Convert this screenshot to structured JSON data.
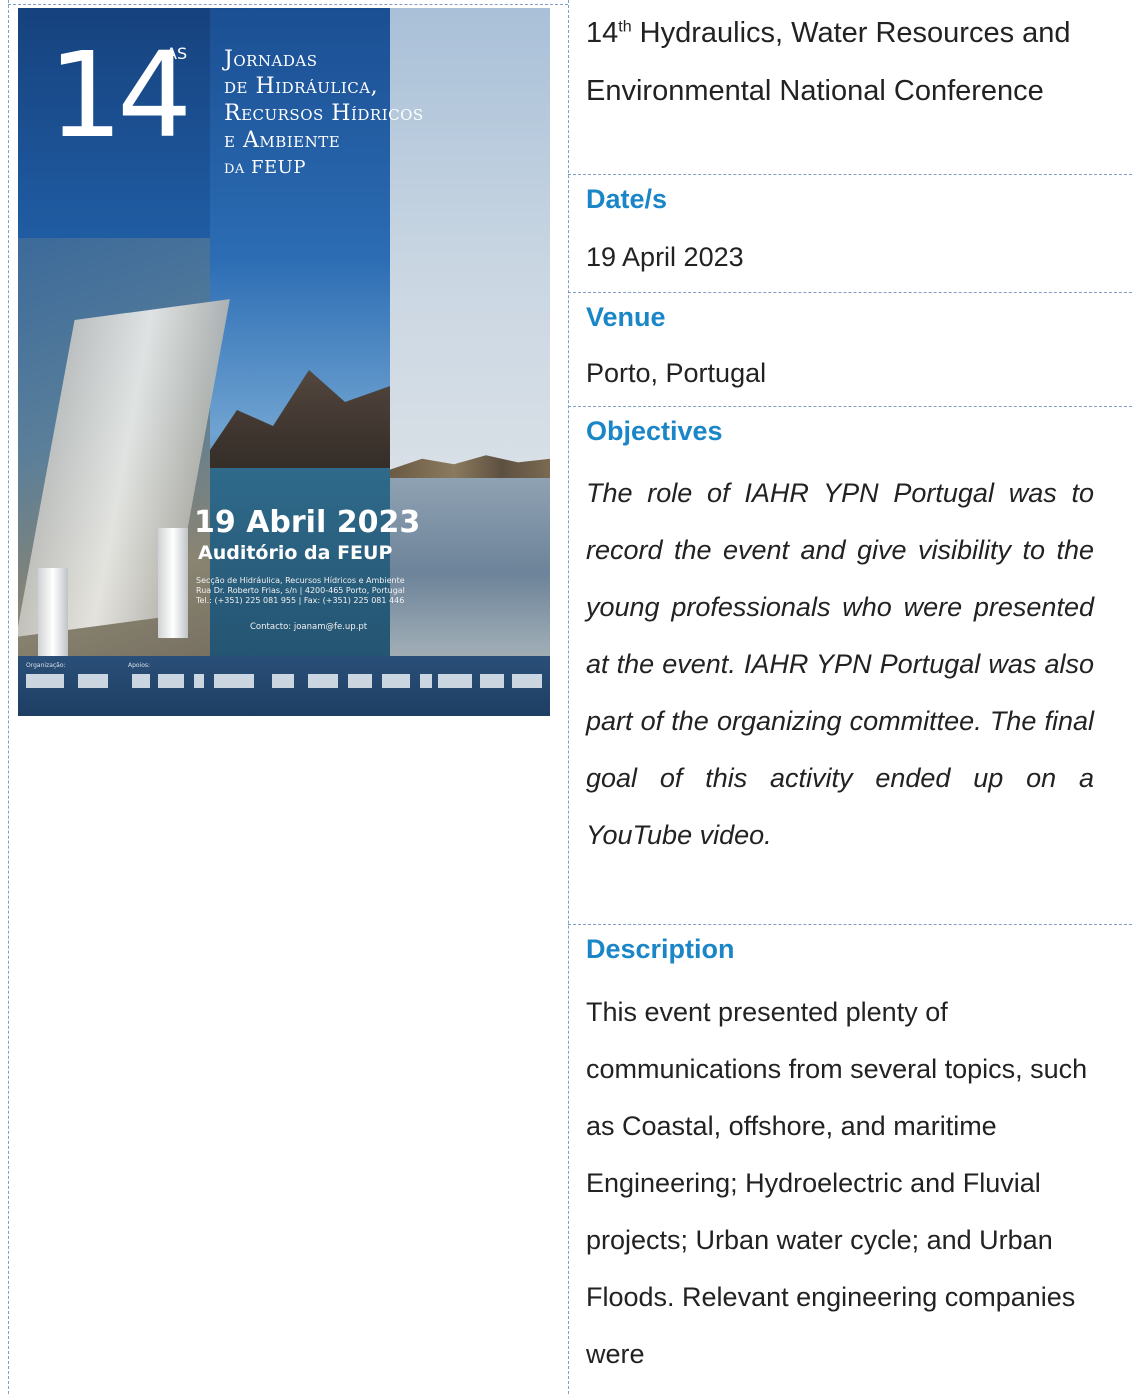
{
  "poster": {
    "number": "14",
    "superscript": "AS",
    "title_lines": [
      "Jornadas",
      "de Hidráulica,",
      "Recursos Hídricos",
      "e Ambiente"
    ],
    "title_small": "da FEUP",
    "date": "19 Abril 2023",
    "venue": "Auditório da FEUP",
    "address_lines": [
      "Secção de Hidráulica, Recursos Hídricos e Ambiente",
      "Rua Dr. Roberto Frias, s/n | 4200-465 Porto, Portugal",
      "Tel.: (+351) 225 081 955 | Fax: (+351) 225 081 446"
    ],
    "contact": "Contacto: joanam@fe.up.pt",
    "logo_labels": {
      "organizers": "Organização:",
      "support": "Apoios:"
    }
  },
  "event": {
    "title_prefix": "14",
    "title_sup": "th",
    "title_line1_rest": " Hydraulics, Water Resources and",
    "title_line2": "Environmental National Conference"
  },
  "fields": {
    "date_label": "Date/s",
    "date_value": "19 April 2023",
    "venue_label": "Venue",
    "venue_value": "Porto, Portugal",
    "objectives_label": "Objectives",
    "objectives_value": "The role of IAHR YPN Portugal was to record the event and give visibility to the young professionals who were presented at the event. IAHR YPN Portugal was also part of the organizing committee. The final goal of this activity ended up on a YouTube video.",
    "description_label": "Description",
    "description_value": "This event presented plenty of communications from several topics, such as Coastal, offshore, and maritime Engineering; Hydroelectric and Fluvial projects; Urban water cycle; and Urban Floods. Relevant engineering companies were"
  }
}
